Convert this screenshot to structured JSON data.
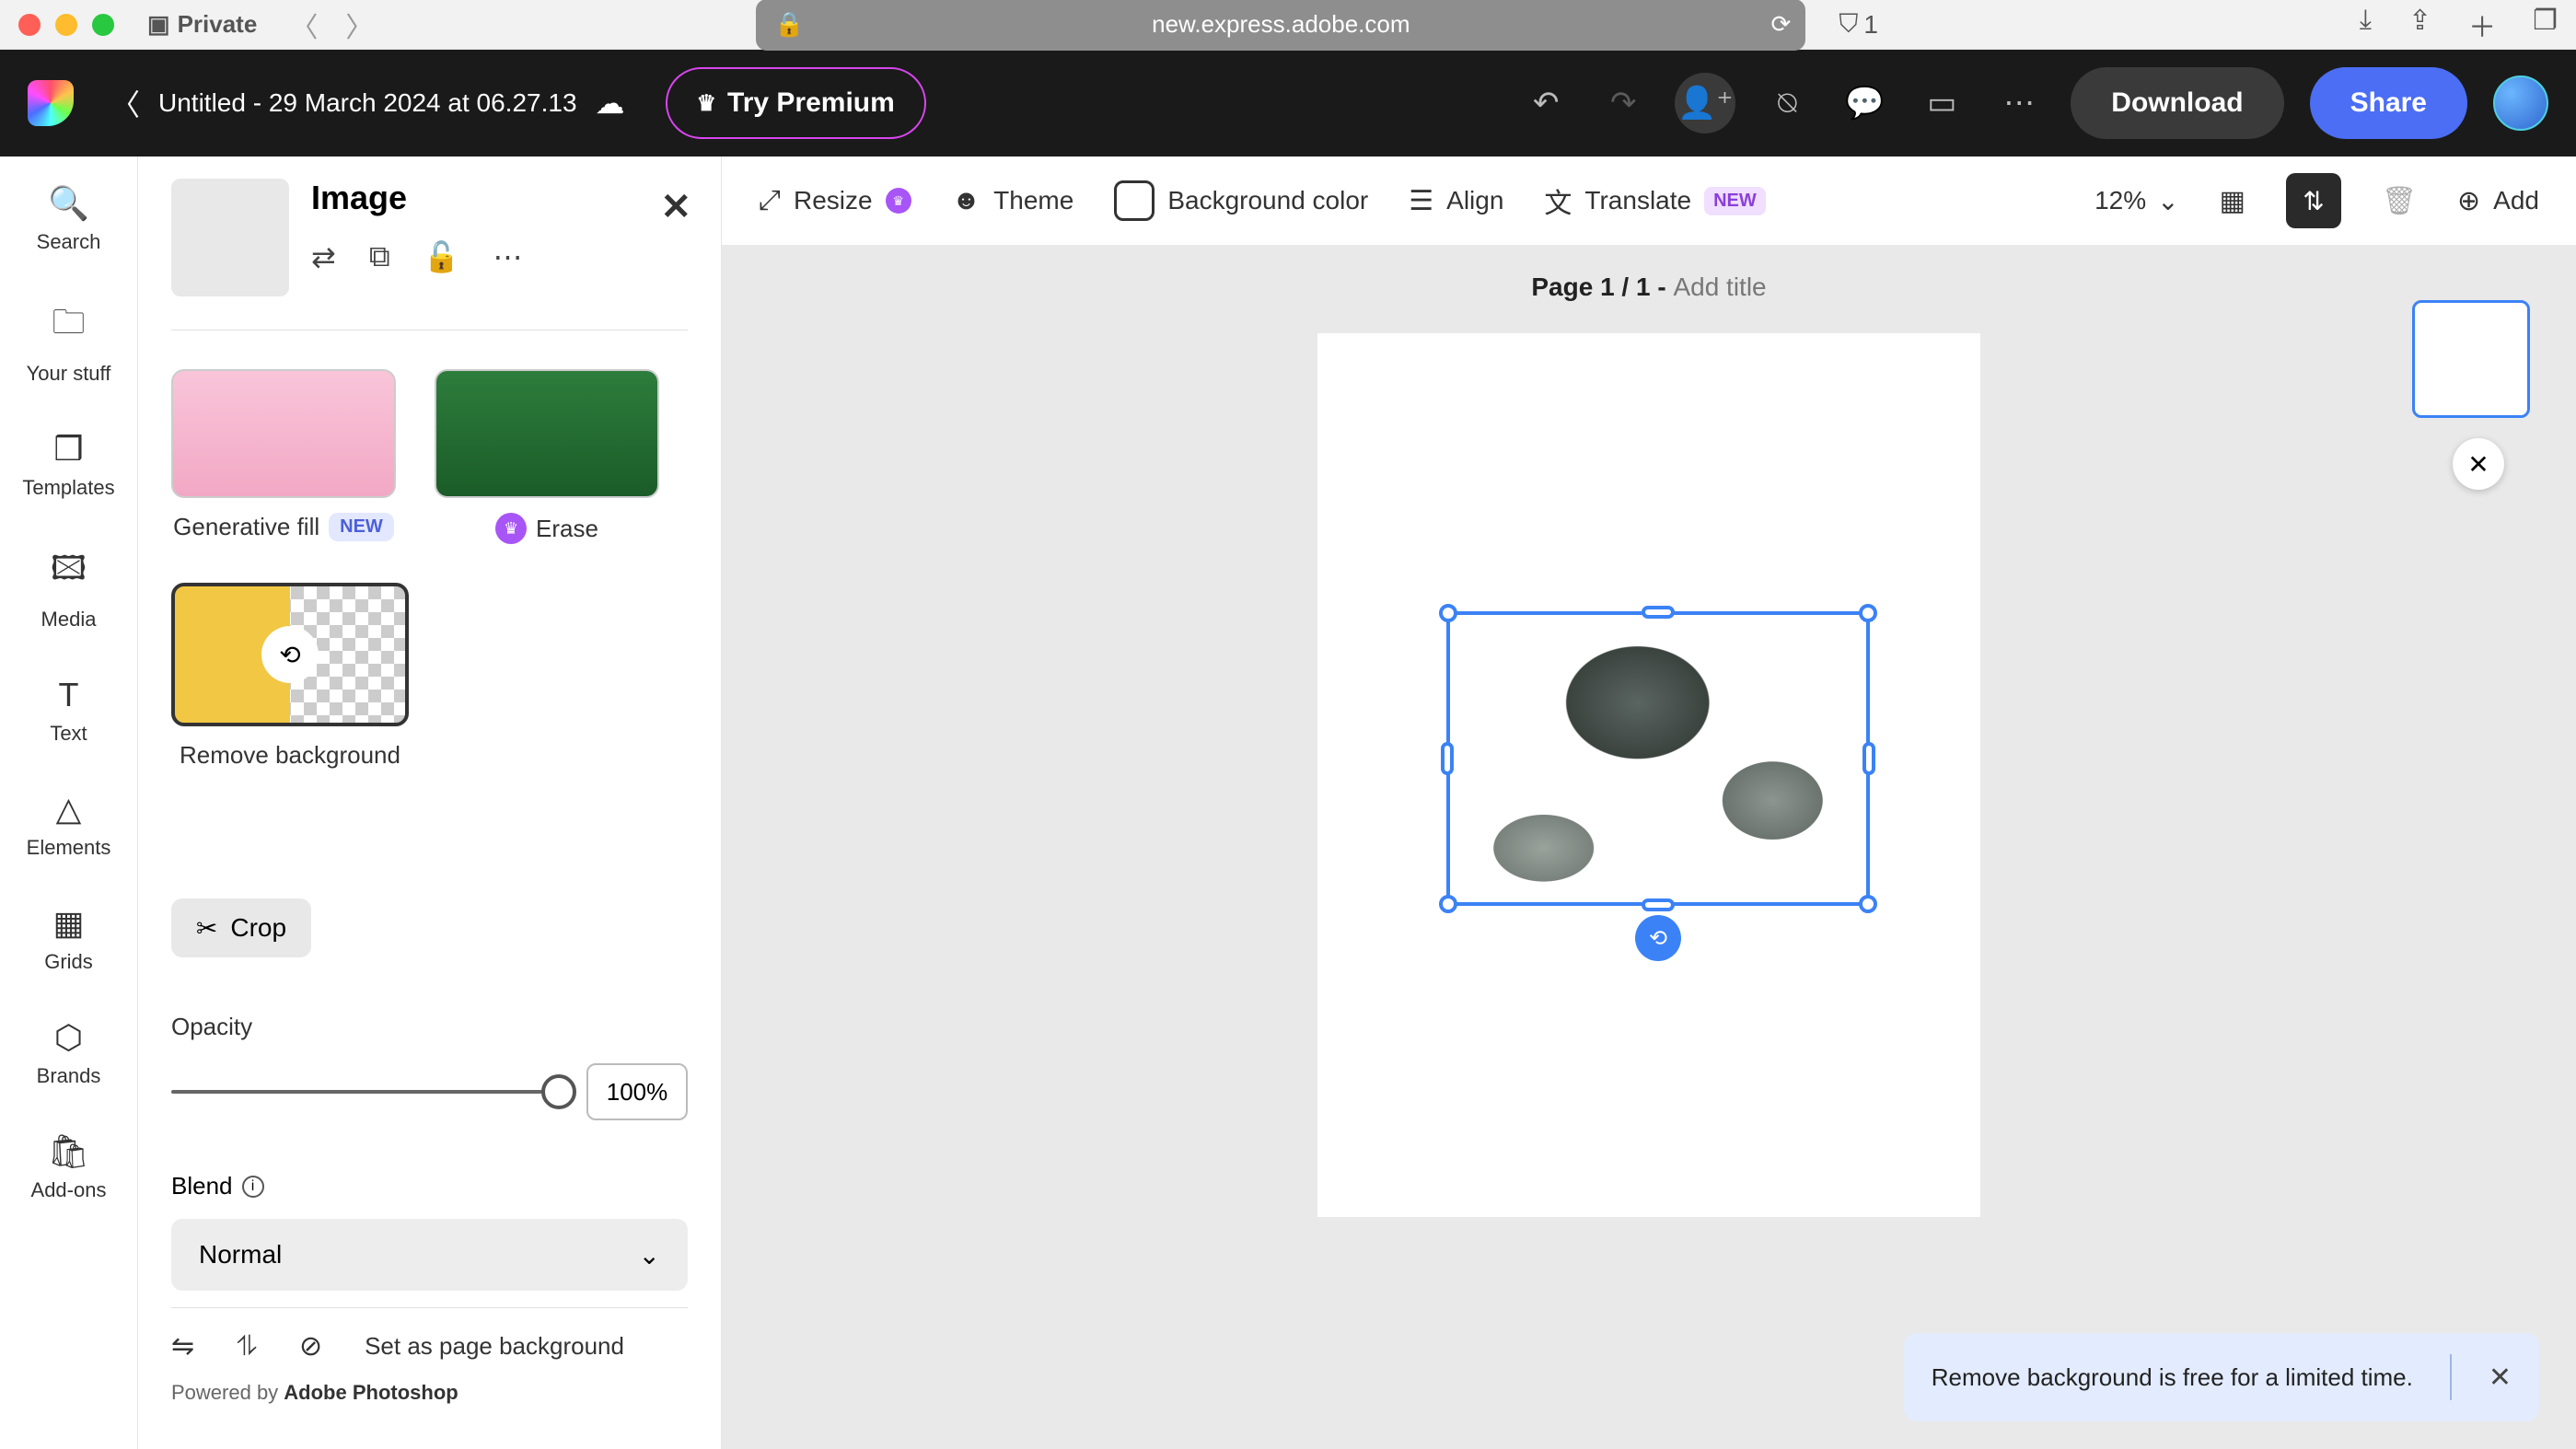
{
  "browser": {
    "private_label": "Private",
    "url": "new.express.adobe.com",
    "shield_count": "1"
  },
  "app_header": {
    "doc_title": "Untitled - 29 March 2024 at 06.27.13",
    "try_premium": "Try Premium",
    "download": "Download",
    "share": "Share"
  },
  "left_rail": {
    "items": [
      {
        "label": "Search"
      },
      {
        "label": "Your stuff"
      },
      {
        "label": "Templates"
      },
      {
        "label": "Media"
      },
      {
        "label": "Text"
      },
      {
        "label": "Elements"
      },
      {
        "label": "Grids"
      },
      {
        "label": "Brands"
      },
      {
        "label": "Add-ons"
      }
    ]
  },
  "side_panel": {
    "title": "Image",
    "generative_fill": "Generative fill",
    "new_pill": "NEW",
    "erase": "Erase",
    "remove_bg": "Remove background",
    "crop": "Crop",
    "opacity_label": "Opacity",
    "opacity_value": "100%",
    "blend_label": "Blend",
    "blend_mode": "Normal",
    "set_as_bg": "Set as page background",
    "powered_prefix": "Powered by ",
    "powered_brand": "Adobe Photoshop"
  },
  "context_bar": {
    "resize": "Resize",
    "theme": "Theme",
    "background_color": "Background color",
    "align": "Align",
    "translate": "Translate",
    "translate_badge": "NEW",
    "zoom": "12%",
    "add": "Add"
  },
  "page": {
    "page_num": "Page 1 / 1 - ",
    "add_title": "Add title"
  },
  "toast": {
    "message": "Remove background is free for a limited time."
  }
}
